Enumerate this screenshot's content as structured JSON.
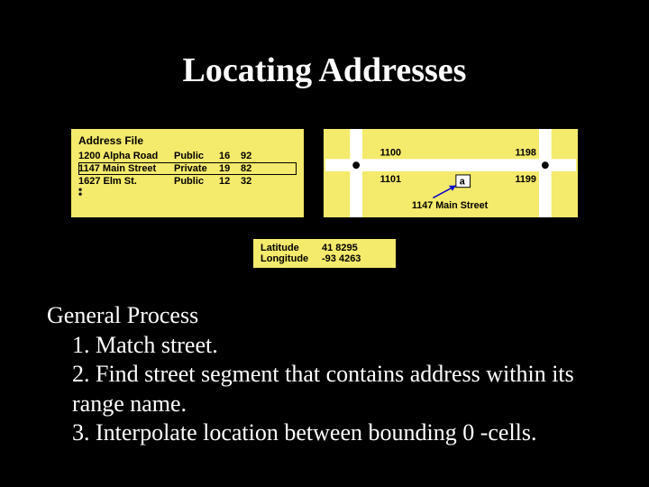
{
  "title": "Locating Addresses",
  "addressFile": {
    "header": "Address File",
    "rows": [
      {
        "addr": "1200 Alpha Road",
        "type": "Public",
        "a": "16",
        "b": "92",
        "selected": false
      },
      {
        "addr": "1147 Main Street",
        "type": "Private",
        "a": "19",
        "b": "82",
        "selected": true
      },
      {
        "addr": "1627 Elm St.",
        "type": "Public",
        "a": "12",
        "b": "32",
        "selected": false
      }
    ]
  },
  "map": {
    "top_left": "1100",
    "top_right": "1198",
    "bottom_left": "1101",
    "bottom_right": "1199",
    "marker_label": "a",
    "marker_caption": "1147 Main Street"
  },
  "coords": {
    "lat_label": "Latitude",
    "lat_value": "41 8295",
    "lon_label": "Longitude",
    "lon_value": "-93 4263"
  },
  "process": {
    "heading": "General Process",
    "items": [
      "1. Match street.",
      "2. Find street segment that contains address within its range name.",
      "3. Interpolate location between bounding 0 -cells."
    ]
  }
}
